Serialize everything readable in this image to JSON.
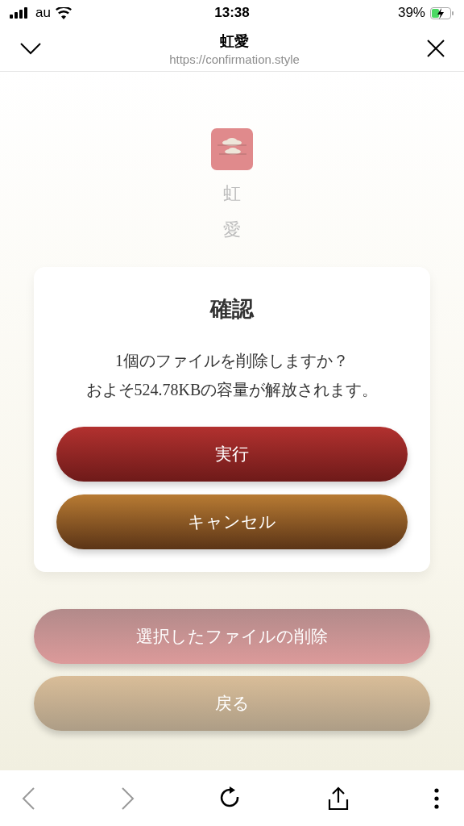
{
  "status_bar": {
    "carrier": "au",
    "time": "13:38",
    "battery": "39%"
  },
  "browser_header": {
    "title": "虹愛",
    "url": "https://confirmation.style"
  },
  "brand": {
    "characters": [
      "虹",
      "愛"
    ]
  },
  "dialog": {
    "title": "確認",
    "message": [
      "1個のファイルを削除しますか？",
      "およそ524.78KBの容量が解放されます。"
    ],
    "buttons": [
      {
        "label": "実行",
        "kind": "danger"
      },
      {
        "label": "キャンセル",
        "kind": "cancel"
      }
    ]
  },
  "page_buttons": [
    {
      "label": "選択したファイルの削除",
      "kind": "delete"
    },
    {
      "label": "戻る",
      "kind": "back"
    }
  ],
  "toolbar": {
    "back_disabled": true,
    "forward_disabled": true
  }
}
